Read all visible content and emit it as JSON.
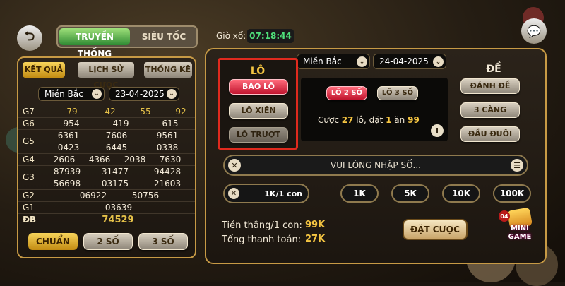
{
  "top": {
    "tab_traditional": "TRUYỀN THỐNG",
    "tab_fast": "SIÊU TỐC",
    "draw_label": "Giờ xổ:",
    "draw_time": "07:18:44"
  },
  "results": {
    "tabs": [
      "KẾT QUẢ",
      "LỊCH SỬ CƯỢC",
      "THỐNG KÊ"
    ],
    "region": "Miền Bắc",
    "date": "23-04-2025",
    "rows": [
      {
        "label": "G7",
        "nums": [
          "79",
          "42",
          "55",
          "92"
        ]
      },
      {
        "label": "G6",
        "nums": [
          "954",
          "419",
          "615"
        ]
      },
      {
        "label": "G5",
        "nums": [
          "6361",
          "7606",
          "9561",
          "0423",
          "6445",
          "0338"
        ]
      },
      {
        "label": "G4",
        "nums": [
          "2606",
          "4366",
          "2038",
          "7630"
        ]
      },
      {
        "label": "G3",
        "nums": [
          "87939",
          "31477",
          "94428",
          "56698",
          "03175",
          "21603"
        ]
      },
      {
        "label": "G2",
        "nums": [
          "06922",
          "50756"
        ]
      },
      {
        "label": "G1",
        "nums": [
          "03639"
        ]
      },
      {
        "label": "ĐB",
        "nums": [
          "74529"
        ]
      }
    ],
    "filters": [
      "CHUẨN",
      "2 SỐ",
      "3 SỐ"
    ]
  },
  "bet": {
    "region": "Miền Bắc",
    "date": "24-04-2025",
    "lo_title": "LÔ",
    "lo_buttons": [
      "BAO LÔ",
      "LÔ XIÊN",
      "LÔ TRƯỢT"
    ],
    "sub_tabs": [
      "LÔ 2 SỐ",
      "LÔ 3 SỐ"
    ],
    "info_prefix": "Cược",
    "info_count": "27",
    "info_mid": "lô, đặt",
    "info_bet": "1",
    "info_mid2": "ăn",
    "info_win": "99",
    "de_title": "ĐỀ",
    "de_buttons": [
      "ĐÁNH ĐỀ",
      "3 CÀNG",
      "ĐẦU ĐUÔI"
    ],
    "input_placeholder": "VUI LÒNG NHẬP SỐ...",
    "stake": "1K/1 con",
    "chips": [
      "1K",
      "5K",
      "10K",
      "100K"
    ],
    "win_label": "Tiền thắng/1 con:",
    "win_value": "99K",
    "total_label": "Tổng thanh toán:",
    "total_value": "27K",
    "place_button": "ĐẶT CƯỢC",
    "mini_game_num": "04",
    "mini_game": "MINI GAME"
  }
}
